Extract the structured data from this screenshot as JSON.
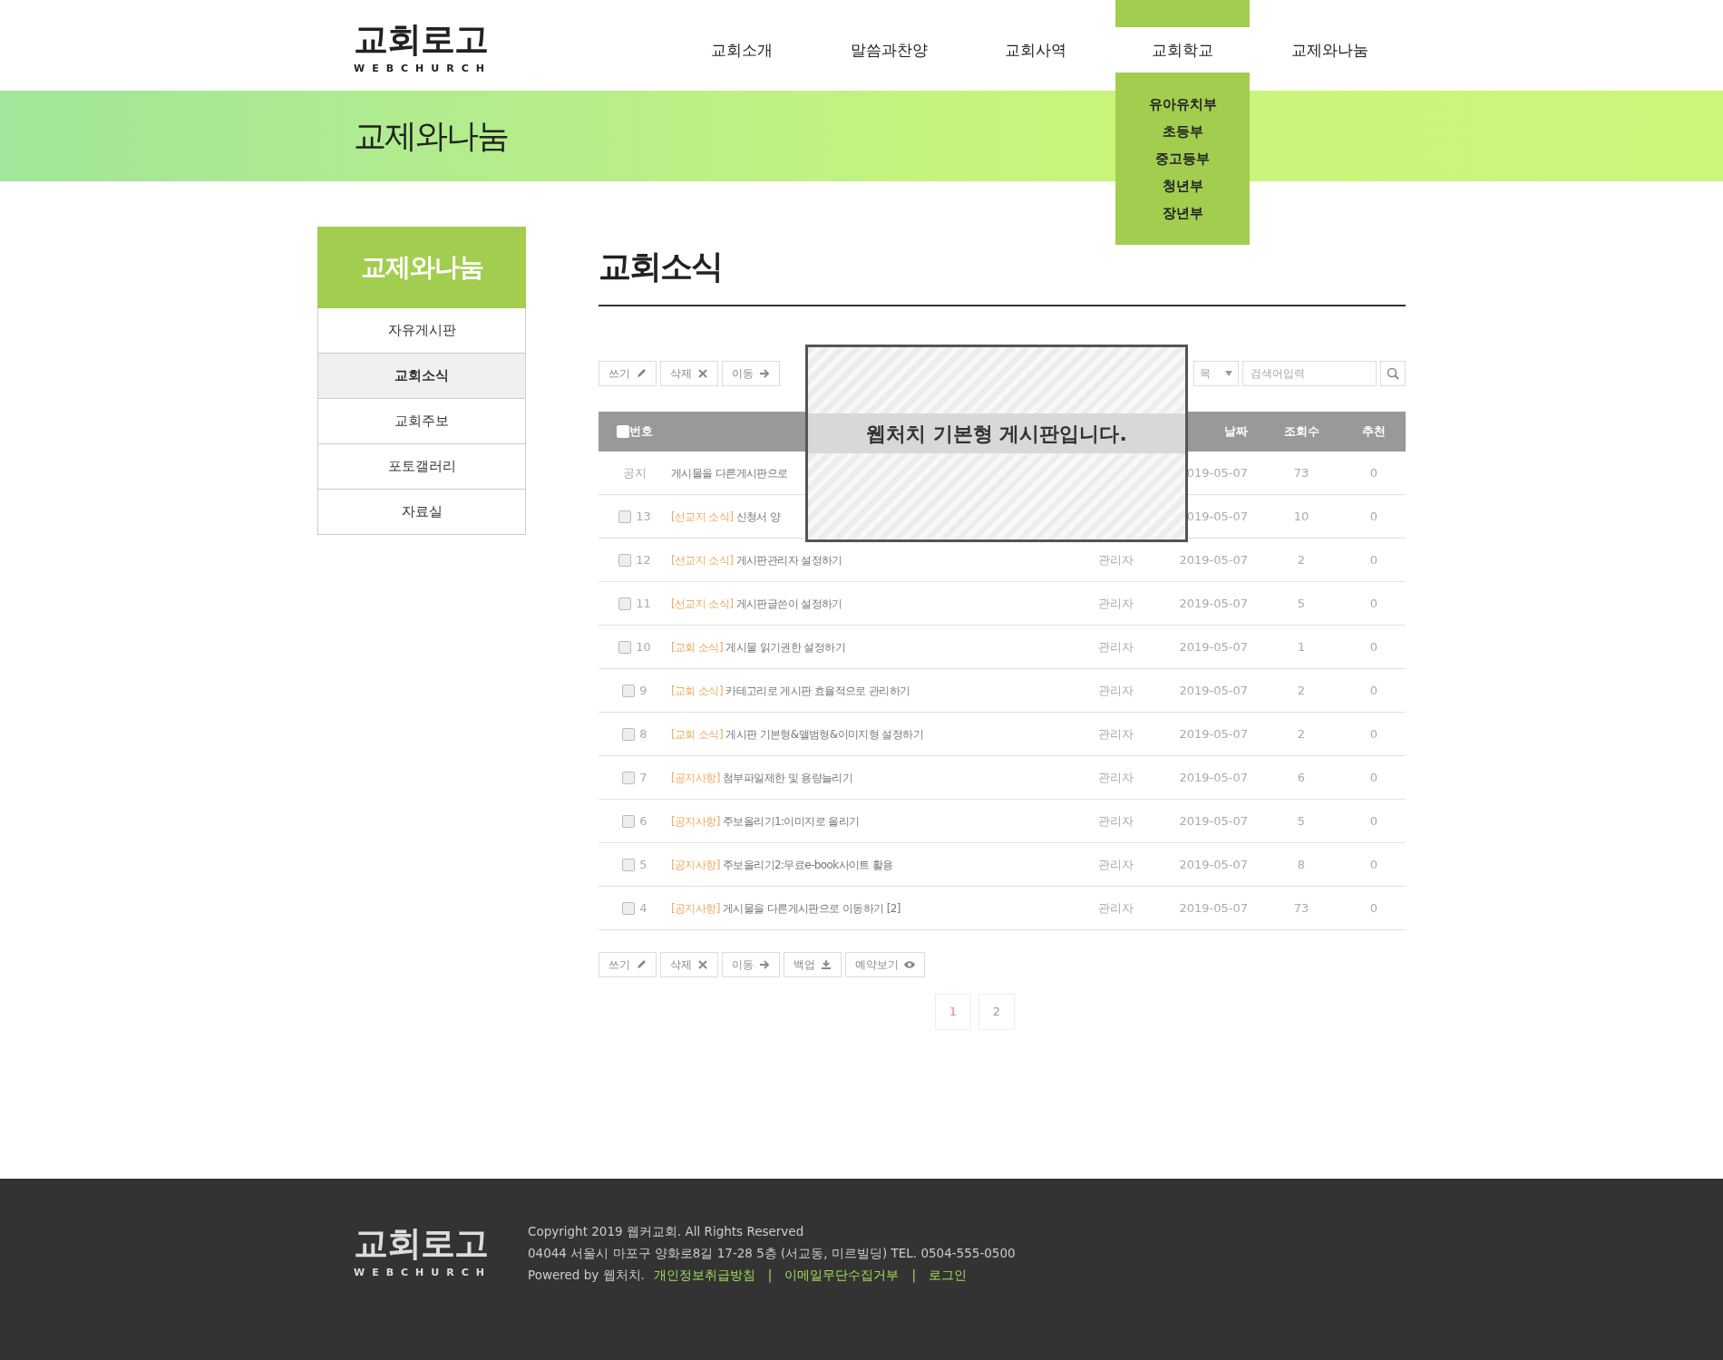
{
  "logo": {
    "title": "교회로고",
    "subtitle": "WEBCHURCH"
  },
  "nav": [
    {
      "label": "교회소개",
      "expanded": false
    },
    {
      "label": "말씀과찬양",
      "expanded": false
    },
    {
      "label": "교회사역",
      "expanded": false
    },
    {
      "label": "교회학교",
      "expanded": true,
      "children": [
        "유아유치부",
        "초등부",
        "중고등부",
        "청년부",
        "장년부"
      ]
    },
    {
      "label": "교제와나눔",
      "expanded": false
    }
  ],
  "banner": {
    "title": "교제와나눔"
  },
  "sidebar": {
    "title": "교제와나눔",
    "items": [
      {
        "label": "자유게시판",
        "selected": false
      },
      {
        "label": "교회소식",
        "selected": true
      },
      {
        "label": "교회주보",
        "selected": false
      },
      {
        "label": "포토갤러리",
        "selected": false
      },
      {
        "label": "자료실",
        "selected": false
      }
    ]
  },
  "page_title": "교회소식",
  "toolbar_top": [
    "쓰기",
    "삭제",
    "이동"
  ],
  "search": {
    "field_select": "목",
    "placeholder": "검색어입력"
  },
  "table": {
    "header_checked": false,
    "columns": [
      "번호",
      "",
      "",
      "날짜",
      "조회수",
      "추천"
    ],
    "rows": [
      {
        "kind": "notice",
        "number": "공지",
        "title": "게시물을 다른게시판으로",
        "date": "019-05-07",
        "views": "73",
        "recommend": "0"
      },
      {
        "kind": "post",
        "checked": false,
        "number": "13",
        "category": "[선교지 소식]",
        "title": "신청서 양",
        "date": "019-05-07",
        "views": "10",
        "recommend": "0"
      },
      {
        "kind": "post",
        "checked": false,
        "number": "12",
        "category": "[선교지 소식]",
        "title": "게시판관리자 설정하기",
        "writer": "관리자",
        "date": "2019-05-07",
        "views": "2",
        "recommend": "0"
      },
      {
        "kind": "post",
        "checked": false,
        "number": "11",
        "category": "[선교지 소식]",
        "title": "게시판글쓴이 설정하기",
        "writer": "관리자",
        "date": "2019-05-07",
        "views": "5",
        "recommend": "0"
      },
      {
        "kind": "post",
        "checked": false,
        "number": "10",
        "category": "[교회 소식]",
        "title": "게시물 읽기권한 설정하기",
        "writer": "관리자",
        "date": "2019-05-07",
        "views": "1",
        "recommend": "0"
      },
      {
        "kind": "post",
        "checked": false,
        "number": "9",
        "category": "[교회 소식]",
        "title": "카테고리로 게시판 효율적으로 관리하기",
        "writer": "관리자",
        "date": "2019-05-07",
        "views": "2",
        "recommend": "0"
      },
      {
        "kind": "post",
        "checked": false,
        "number": "8",
        "category": "[교회 소식]",
        "title": "게시판 기본형&앨범형&이미지형 설정하기",
        "writer": "관리자",
        "date": "2019-05-07",
        "views": "2",
        "recommend": "0"
      },
      {
        "kind": "post",
        "checked": false,
        "number": "7",
        "category": "[공지사항]",
        "title": "첨부파일제한 및 용량늘리기",
        "writer": "관리자",
        "date": "2019-05-07",
        "views": "6",
        "recommend": "0"
      },
      {
        "kind": "post",
        "checked": false,
        "number": "6",
        "category": "[공지사항]",
        "title": "주보올리기1:이미지로 올리기",
        "writer": "관리자",
        "date": "2019-05-07",
        "views": "5",
        "recommend": "0"
      },
      {
        "kind": "post",
        "checked": false,
        "number": "5",
        "category": "[공지사항]",
        "title": "주보올리기2:무료e-book사이트 활용",
        "writer": "관리자",
        "date": "2019-05-07",
        "views": "8",
        "recommend": "0"
      },
      {
        "kind": "post",
        "checked": false,
        "number": "4",
        "category": "[공지사항]",
        "title": "게시물을 다른게시판으로 이동하기 [2]",
        "writer": "관리자",
        "date": "2019-05-07",
        "views": "73",
        "recommend": "0"
      }
    ]
  },
  "toolbar_bottom": [
    "쓰기",
    "삭제",
    "이동",
    "백업",
    "예약보기"
  ],
  "pagination": [
    {
      "label": "1",
      "selected": true
    },
    {
      "label": "2",
      "selected": false
    }
  ],
  "popup": {
    "message": "웹처치 기본형 게시판입니다."
  },
  "footer": {
    "logo": {
      "title": "교회로고",
      "subtitle": "WEBCHURCH"
    },
    "copyright": "Copyright 2019  웹커교회. All Rights Reserved",
    "address": "04044 서울시 마포구 양화로8길 17-28 5층 (서교동, 미르빌딩) TEL. 0504-555-0500",
    "powered": "Powered by 웹처치.",
    "links": [
      {
        "kind": "link",
        "text": "개인정보취급방침"
      },
      {
        "kind": "separator",
        "text": "|"
      },
      {
        "kind": "link",
        "text": "이메일무단수집거부"
      },
      {
        "kind": "separator",
        "text": "|"
      },
      {
        "kind": "link",
        "text": "로그인"
      }
    ]
  }
}
